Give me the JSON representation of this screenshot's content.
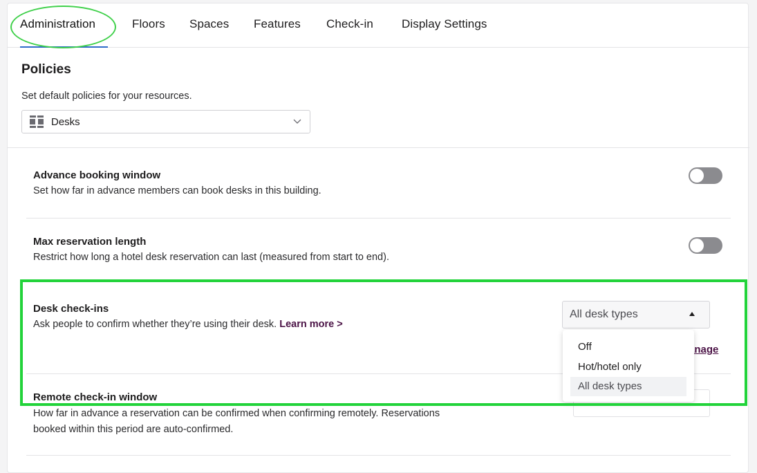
{
  "tabs": [
    {
      "label": "Administration",
      "active": true
    },
    {
      "label": "Floors"
    },
    {
      "label": "Spaces"
    },
    {
      "label": "Features"
    },
    {
      "label": "Check-in"
    },
    {
      "label": "Display Settings"
    }
  ],
  "policies": {
    "title": "Policies",
    "description": "Set default policies for your resources.",
    "resource_select": {
      "value": "Desks",
      "icon": "desk-icon"
    }
  },
  "settings": {
    "advance_booking": {
      "title": "Advance booking window",
      "description": "Set how far in advance members can book desks in this building.",
      "enabled": false
    },
    "max_reservation": {
      "title": "Max reservation length",
      "description": "Restrict how long a hotel desk reservation can last (measured from start to end).",
      "enabled": false
    },
    "desk_checkins": {
      "title": "Desk check-ins",
      "description": "Ask people to confirm whether they’re using their desk.",
      "learn_more": "Learn more >",
      "select_value": "All desk types",
      "manage_link_visible": "anage",
      "options": [
        "Off",
        "Hot/hotel only",
        "All desk types"
      ],
      "selected_option": "All desk types"
    },
    "remote_checkin": {
      "title": "Remote check-in window",
      "description_line1": "How far in advance a reservation can be confirmed when confirming remotely. Reservations",
      "description_line2": "booked within this period are auto-confirmed."
    }
  },
  "colors": {
    "accent_tab": "#2f6bc9",
    "link": "#4a1245",
    "toggle_off": "#8b8b8f",
    "annotation_green": "#22d33a"
  }
}
